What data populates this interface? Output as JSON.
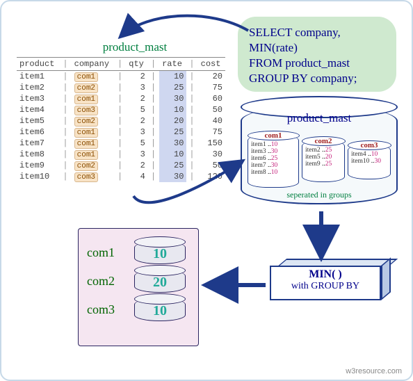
{
  "sql": {
    "line1": "SELECT company,",
    "line2": "MIN(rate)",
    "line3": "FROM product_mast",
    "line4": "GROUP BY company;"
  },
  "table": {
    "title": "product_mast",
    "headers": {
      "product": "product",
      "company": "company",
      "qty": "qty",
      "rate": "rate",
      "cost": "cost"
    },
    "rows": [
      {
        "product": "item1",
        "company": "com1",
        "qty": 2,
        "rate": 10,
        "cost": 20
      },
      {
        "product": "item2",
        "company": "com2",
        "qty": 3,
        "rate": 25,
        "cost": 75
      },
      {
        "product": "item3",
        "company": "com1",
        "qty": 2,
        "rate": 30,
        "cost": 60
      },
      {
        "product": "item4",
        "company": "com3",
        "qty": 5,
        "rate": 10,
        "cost": 50
      },
      {
        "product": "item5",
        "company": "com2",
        "qty": 2,
        "rate": 20,
        "cost": 40
      },
      {
        "product": "item6",
        "company": "com1",
        "qty": 3,
        "rate": 25,
        "cost": 75
      },
      {
        "product": "item7",
        "company": "com1",
        "qty": 5,
        "rate": 30,
        "cost": 150
      },
      {
        "product": "item8",
        "company": "com1",
        "qty": 3,
        "rate": 10,
        "cost": 30
      },
      {
        "product": "item9",
        "company": "com2",
        "qty": 2,
        "rate": 25,
        "cost": 50
      },
      {
        "product": "item10",
        "company": "com3",
        "qty": 4,
        "rate": 30,
        "cost": 120
      }
    ]
  },
  "db": {
    "title": "product_mast",
    "footer": "seperated in groups",
    "groups": [
      {
        "name": "com1",
        "rows": [
          {
            "item": "item1",
            "rate": 10
          },
          {
            "item": "item3",
            "rate": 30
          },
          {
            "item": "item6",
            "rate": 25
          },
          {
            "item": "item7",
            "rate": 30
          },
          {
            "item": "item8",
            "rate": 10
          }
        ]
      },
      {
        "name": "com2",
        "rows": [
          {
            "item": "item2",
            "rate": 25
          },
          {
            "item": "item5",
            "rate": 20
          },
          {
            "item": "item9",
            "rate": 25
          }
        ]
      },
      {
        "name": "com3",
        "rows": [
          {
            "item": "item4",
            "rate": 10
          },
          {
            "item": "item10",
            "rate": 30
          }
        ]
      }
    ]
  },
  "minbox": {
    "title": "MIN( )",
    "subtitle": "with GROUP BY"
  },
  "result": {
    "rows": [
      {
        "label": "com1",
        "value": 10
      },
      {
        "label": "com2",
        "value": 20
      },
      {
        "label": "com3",
        "value": 10
      }
    ]
  },
  "watermark": "w3resource.com"
}
